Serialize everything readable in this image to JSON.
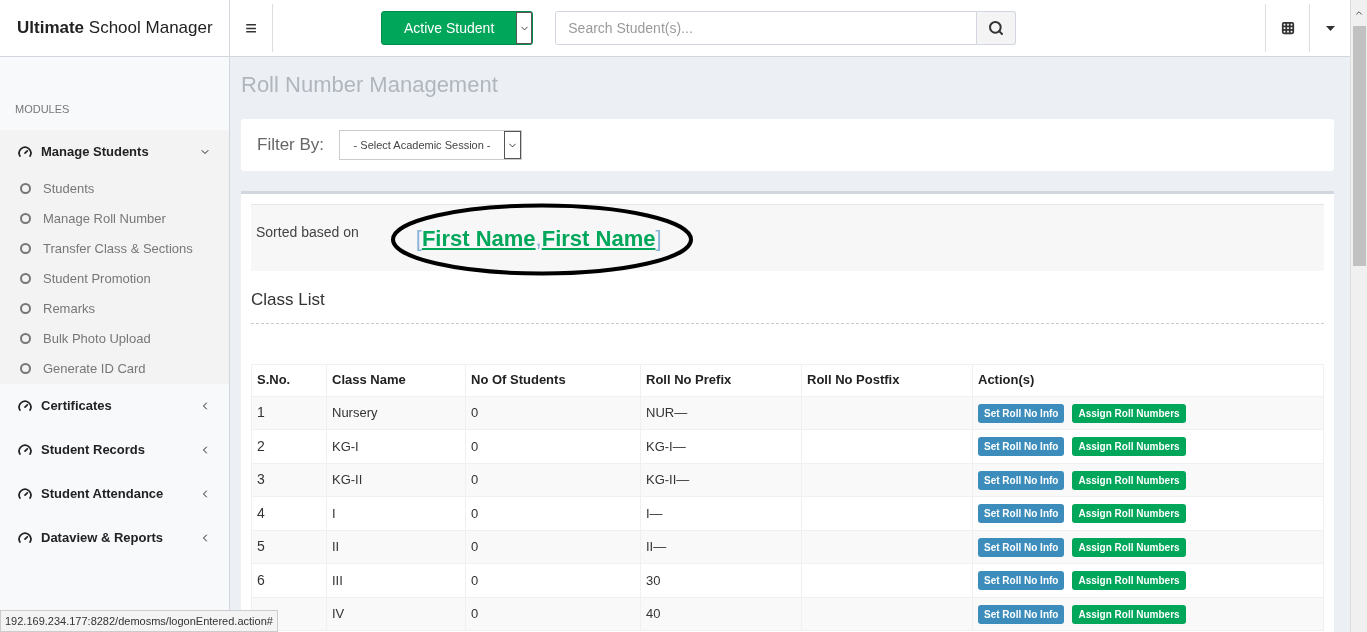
{
  "header": {
    "brand_bold": "Ultimate",
    "brand_rest": "School Manager",
    "menu_glyph": "≡",
    "student_button": "Active Student",
    "search": {
      "placeholder": "Search Student(s)..."
    }
  },
  "sidebar": {
    "section": "MODULES",
    "items": [
      {
        "label": "Manage Students",
        "expanded": true,
        "children": [
          {
            "label": "Students"
          },
          {
            "label": "Manage Roll Number"
          },
          {
            "label": "Transfer Class & Sections"
          },
          {
            "label": "Student Promotion"
          },
          {
            "label": "Remarks"
          },
          {
            "label": "Bulk Photo Upload"
          },
          {
            "label": "Generate ID Card"
          }
        ]
      },
      {
        "label": "Certificates",
        "expanded": false
      },
      {
        "label": "Student Records",
        "expanded": false
      },
      {
        "label": "Student Attendance",
        "expanded": false
      },
      {
        "label": "Dataview & Reports",
        "expanded": false
      }
    ]
  },
  "page_title": "Roll Number Management",
  "filter": {
    "label": "Filter By:",
    "select": "- Select Academic Session -"
  },
  "sorted": {
    "label": "Sorted based on",
    "open": "[",
    "fields": [
      "First Name",
      "First Name"
    ],
    "separator": ",",
    "close": "]"
  },
  "class_list": {
    "title": "Class List",
    "columns": [
      "S.No.",
      "Class Name",
      "No Of Students",
      "Roll No Prefix",
      "Roll No Postfix",
      "Action(s)"
    ],
    "rows": [
      {
        "sno": "1",
        "class": "Nursery",
        "students": "0",
        "prefix": "NUR—",
        "actions": [
          "Set Roll No Info",
          "Assign Roll Numbers"
        ]
      },
      {
        "sno": "2",
        "class": "KG-I",
        "students": "0",
        "prefix": "KG-I—",
        "actions": [
          "Set Roll No Info",
          "Assign Roll Numbers"
        ]
      },
      {
        "sno": "3",
        "class": "KG-II",
        "students": "0",
        "prefix": "KG-II—",
        "actions": [
          "Set Roll No Info",
          "Assign Roll Numbers"
        ]
      },
      {
        "sno": "4",
        "class": "I",
        "students": "0",
        "prefix": "I—",
        "actions": [
          "Set Roll No Info",
          "Assign Roll Numbers"
        ]
      },
      {
        "sno": "5",
        "class": "II",
        "students": "0",
        "prefix": "II—",
        "actions": [
          "Set Roll No Info",
          "Assign Roll Numbers"
        ]
      },
      {
        "sno": "6",
        "class": "III",
        "students": "0",
        "prefix": "30",
        "actions": [
          "Set Roll No Info",
          "Assign Roll Numbers"
        ]
      },
      {
        "class": "IV",
        "students": "0",
        "prefix": "40",
        "actions": [
          "Set Roll No Info",
          "Assign Roll Numbers"
        ]
      }
    ]
  },
  "status_url": "192.169.234.177:8282/demosms/logonEntered.action#"
}
